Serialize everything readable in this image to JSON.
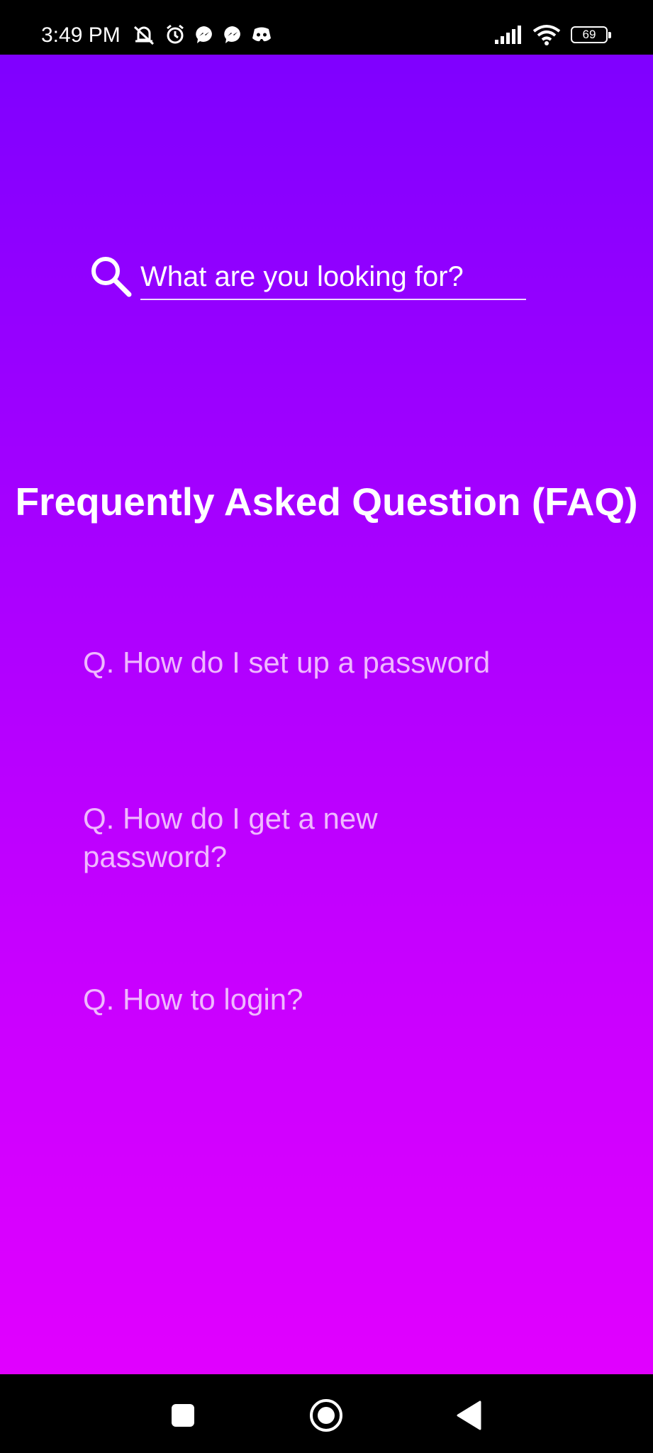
{
  "status_bar": {
    "time": "3:49 PM",
    "battery_level": "69"
  },
  "search": {
    "placeholder": "What are you looking for?"
  },
  "page": {
    "title": "Frequently Asked Question (FAQ)"
  },
  "faq": {
    "items": [
      {
        "question": "Q. How do I set up a password"
      },
      {
        "question": "Q. How do I get a new password?"
      },
      {
        "question": "Q. How to login?"
      }
    ]
  },
  "colors": {
    "gradient_top": "#7f00ff",
    "gradient_bottom": "#e100ff",
    "question_text": "#f0b8ff",
    "bars": "#000000"
  },
  "icons": {
    "left_status": [
      "mute-icon",
      "alarm-icon",
      "messenger-icon",
      "messenger-icon",
      "discord-icon"
    ],
    "right_status": [
      "signal-icon",
      "wifi-icon",
      "battery-icon"
    ],
    "navigation": [
      "recents-square-icon",
      "home-circle-icon",
      "back-triangle-icon"
    ]
  }
}
